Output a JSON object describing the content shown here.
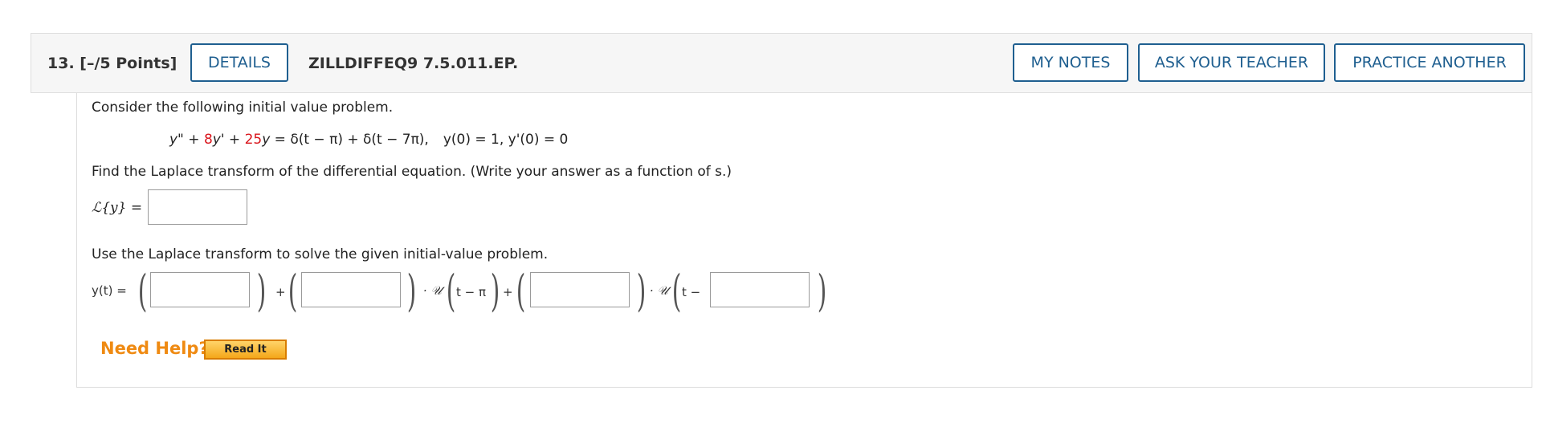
{
  "header": {
    "question_label": "13. [–/5 Points]",
    "details_label": "DETAILS",
    "problem_id": "ZILLDIFFEQ9 7.5.011.EP.",
    "my_notes_label": "MY NOTES",
    "ask_teacher_label": "ASK YOUR TEACHER",
    "practice_label": "PRACTICE ANOTHER"
  },
  "problem": {
    "intro": "Consider the following initial value problem.",
    "equation": {
      "y2": "y\"",
      "plus1": " + ",
      "coef1": "8",
      "y1": "y'",
      "plus2": " + ",
      "coef2": "25",
      "y0": "y",
      "rhs": " = δ(t − π) + δ(t − 7π),",
      "ic": "y(0) = 1,  y'(0) = 0"
    },
    "part1_prompt": "Find the Laplace transform of the differential equation. (Write your answer as a function of s.)",
    "laplace_lhs": "ℒ{y} =",
    "part2_prompt": "Use the Laplace transform to solve the given initial-value problem.",
    "solution_lhs": "y(t) =",
    "plus_sign": "+",
    "dot_u": "· 𝒰",
    "shift1": "t − π",
    "shift2": "t −"
  },
  "help": {
    "need_help": "Need Help?",
    "read_it": "Read It"
  }
}
